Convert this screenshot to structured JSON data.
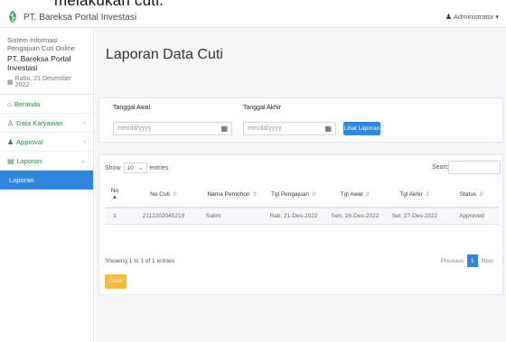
{
  "caption": "melakukan cuti.",
  "app": {
    "title": "PT. Bareksa Portal Investasi",
    "user": "Administrator"
  },
  "sidebar": {
    "system_name": "Sistem Informasi Pengajuan Cuti Online",
    "company": "PT. Bareksa Portal Investasi",
    "date": "Rabu, 21 Desember 2022",
    "items": [
      {
        "label": "Beranda",
        "icon": "home-icon"
      },
      {
        "label": "Data Karyawan",
        "icon": "users-icon"
      },
      {
        "label": "Approval",
        "icon": "user-check-icon"
      },
      {
        "label": "Laporan",
        "icon": "report-icon"
      },
      {
        "label": "Laporan",
        "icon": "none"
      }
    ]
  },
  "page": {
    "title": "Laporan Data Cuti"
  },
  "filter": {
    "start_label": "Tanggal Awal",
    "start_placeholder": "mm/dd/yyyy",
    "end_label": "Tanggal Akhir",
    "end_placeholder": "mm/dd/yyyy",
    "button": "Lihat Laporan"
  },
  "table": {
    "show_label": "Show",
    "show_value": "10",
    "entries_label": "entries",
    "search_label": "Search:",
    "headers": [
      "No",
      "No Cuti",
      "Nama Pemohon",
      "Tgl Pengajuan",
      "Tgl Awal",
      "Tgl Akhir",
      "Status"
    ],
    "rows": [
      [
        "1",
        "2112202045219",
        "Salim",
        "Rab, 21-Des-2022",
        "Sen, 26-Des-2022",
        "Sel, 27-Des-2022",
        "Approved"
      ]
    ],
    "info": "Showing 1 to 1 of 1 entries",
    "pager": {
      "prev": "Previous",
      "page": "1",
      "next": "Next"
    },
    "print_button": "Cetak"
  },
  "colors": {
    "primary": "#2e86de",
    "sidebar_text": "#2c8a3d",
    "print": "#f6b93b"
  }
}
